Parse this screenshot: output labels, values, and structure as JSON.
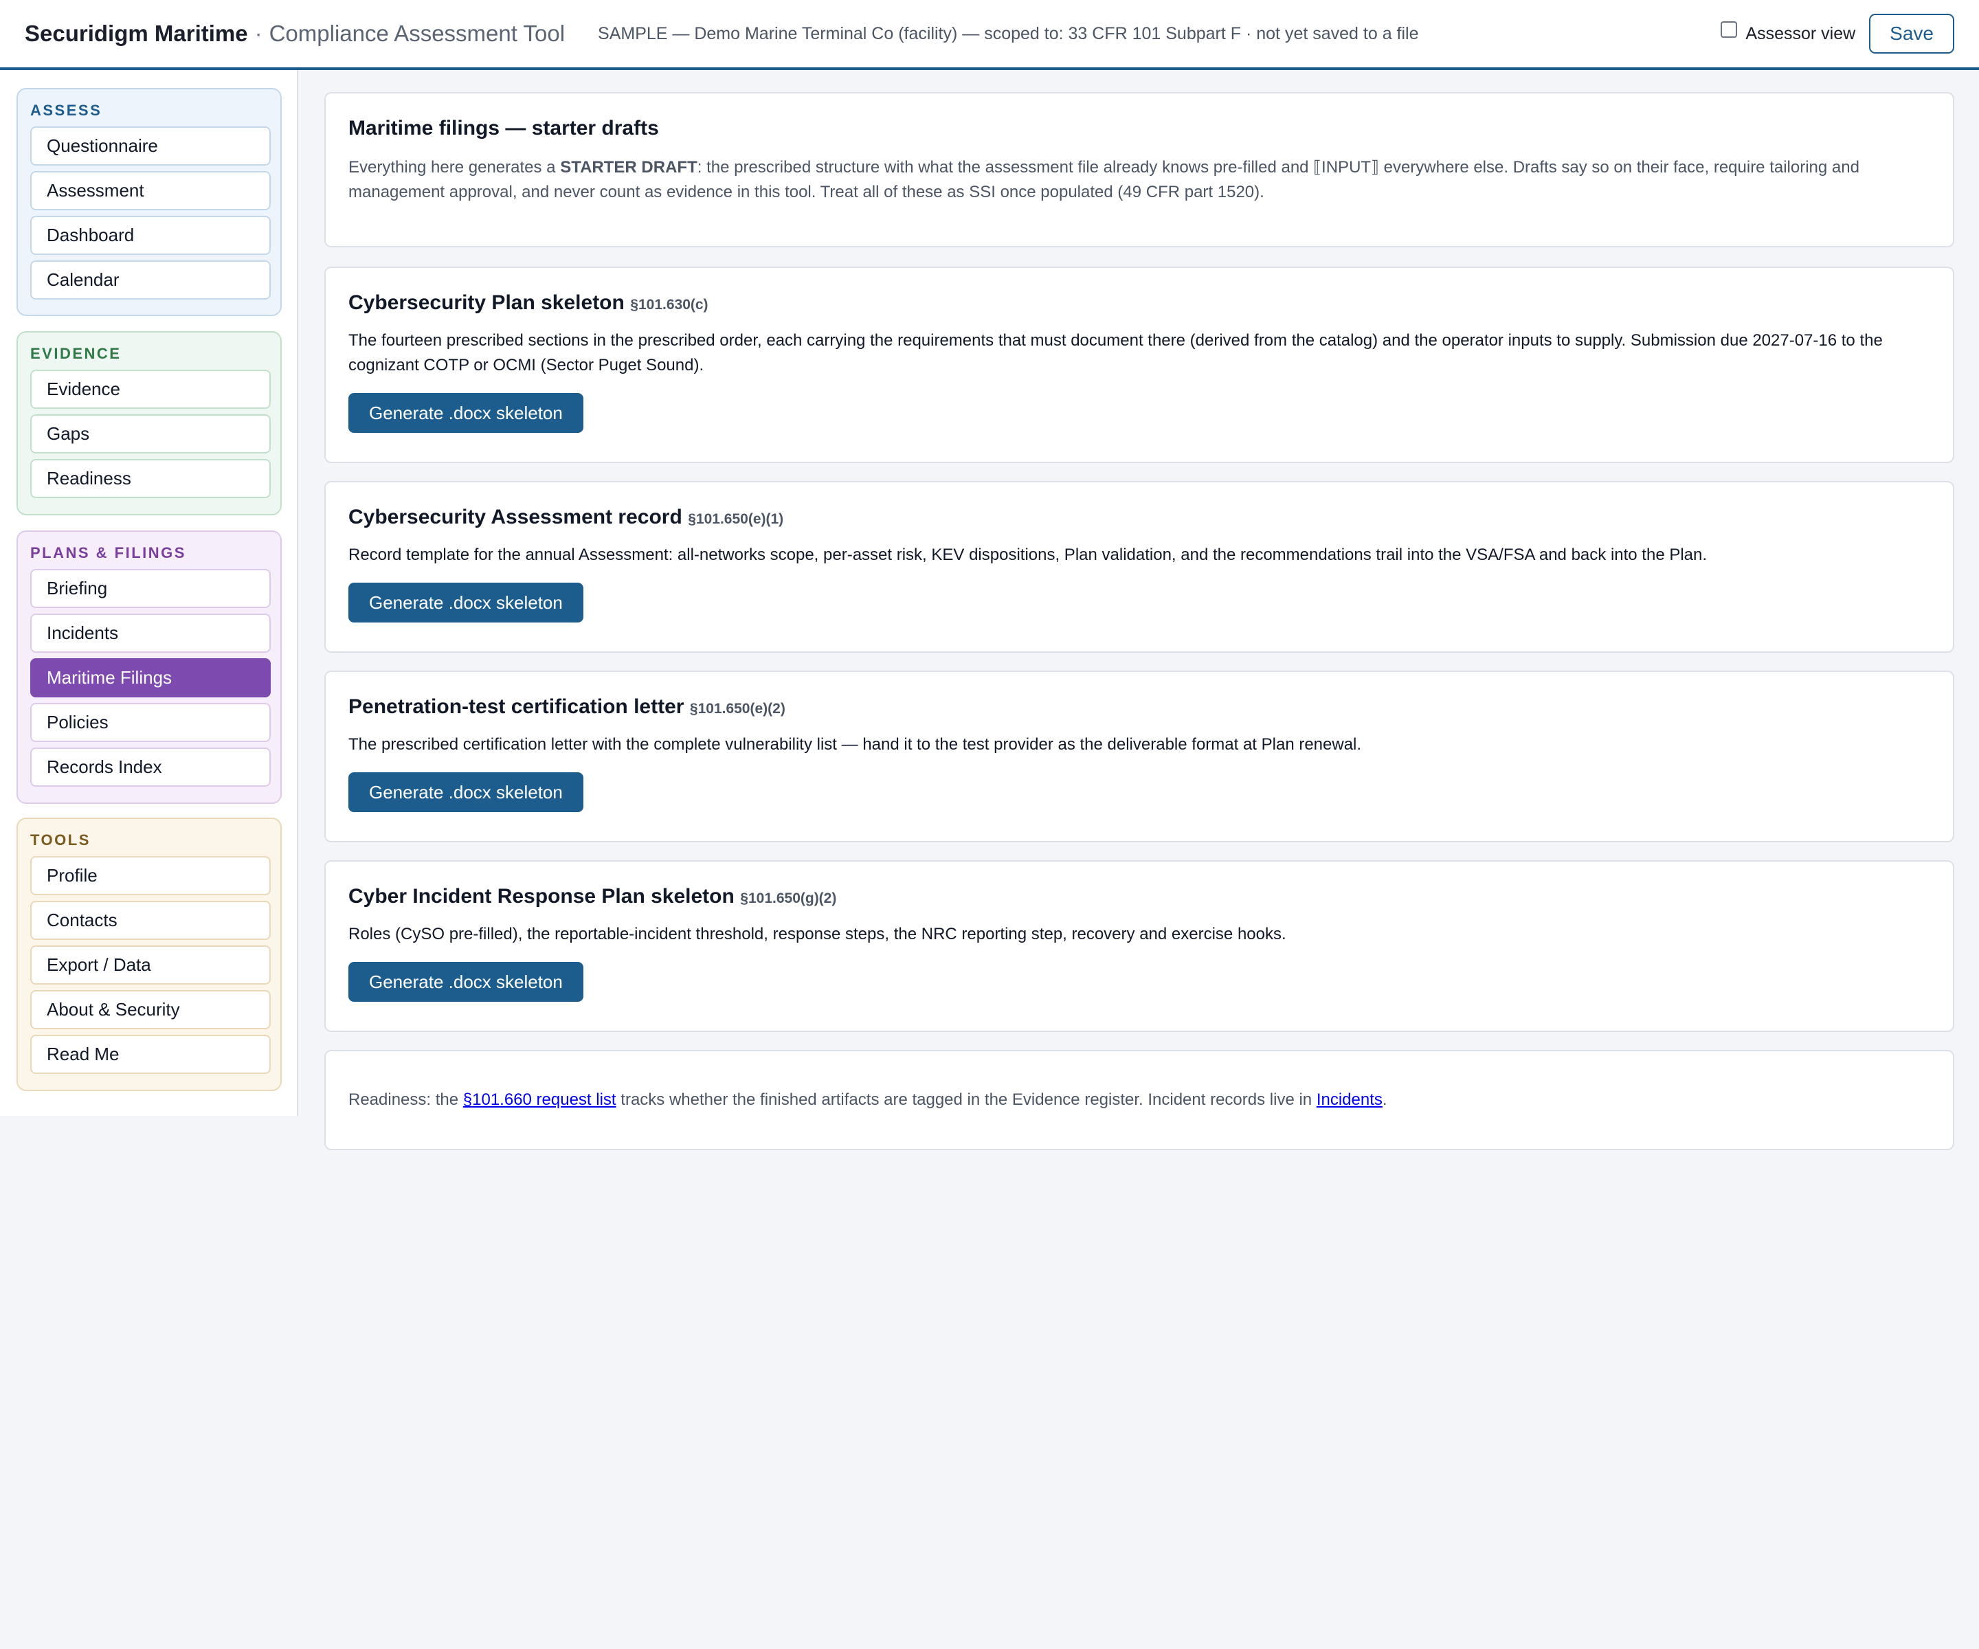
{
  "header": {
    "brand": "Securidigm Maritime",
    "separator": "·",
    "subtitle": "Compliance Assessment Tool",
    "file_status": "SAMPLE — Demo Marine Terminal Co (facility) — scoped to: 33 CFR 101 Subpart F · not yet saved to a file",
    "assessor_label": "Assessor view",
    "save_label": "Save"
  },
  "sidebar": {
    "assess": {
      "title": "Assess",
      "items": [
        "Questionnaire",
        "Assessment",
        "Dashboard",
        "Calendar"
      ]
    },
    "evidence": {
      "title": "Evidence",
      "items": [
        "Evidence",
        "Gaps",
        "Readiness"
      ]
    },
    "plans": {
      "title": "Plans & Filings",
      "items": [
        "Briefing",
        "Incidents",
        "Maritime Filings",
        "Policies",
        "Records Index"
      ],
      "active": "Maritime Filings"
    },
    "tools": {
      "title": "Tools",
      "items": [
        "Profile",
        "Contacts",
        "Export / Data",
        "About & Security",
        "Read Me"
      ]
    }
  },
  "intro": {
    "title": "Maritime filings — starter drafts",
    "body_pre": "Everything here generates a ",
    "body_strong": "STARTER DRAFT",
    "body_post": ": the prescribed structure with what the assessment file already knows pre-filled and ⟦INPUT⟧ everywhere else. Drafts say so on their face, require tailoring and management approval, and never count as evidence in this tool. Treat all of these as SSI once populated (49 CFR part 1520)."
  },
  "filings": [
    {
      "title": "Cybersecurity Plan skeleton",
      "section": "§101.630(c)",
      "description": "The fourteen prescribed sections in the prescribed order, each carrying the requirements that must document there (derived from the catalog) and the operator inputs to supply. Submission due 2027-07-16 to the cognizant COTP or OCMI (Sector Puget Sound).",
      "button": "Generate .docx skeleton"
    },
    {
      "title": "Cybersecurity Assessment record",
      "section": "§101.650(e)(1)",
      "description": "Record template for the annual Assessment: all-networks scope, per-asset risk, KEV dispositions, Plan validation, and the recommendations trail into the VSA/FSA and back into the Plan.",
      "button": "Generate .docx skeleton"
    },
    {
      "title": "Penetration-test certification letter",
      "section": "§101.650(e)(2)",
      "description": "The prescribed certification letter with the complete vulnerability list — hand it to the test provider as the deliverable format at Plan renewal.",
      "button": "Generate .docx skeleton"
    },
    {
      "title": "Cyber Incident Response Plan skeleton",
      "section": "§101.650(g)(2)",
      "description": "Roles (CySO pre-filled), the reportable-incident threshold, response steps, the NRC reporting step, recovery and exercise hooks.",
      "button": "Generate .docx skeleton"
    }
  ],
  "footer_note": {
    "pre": "Readiness: the ",
    "link1": "§101.660 request list",
    "mid": " tracks whether the finished artifacts are tagged in the Evidence register. Incident records live in ",
    "link2": "Incidents",
    "post": "."
  },
  "colors": {
    "accent": "#1d5d8e",
    "active_nav": "#7d4baf",
    "assess": "#1d5d8e",
    "evidence": "#2f7a47",
    "plans": "#7a3e9d",
    "tools": "#7a5a1e"
  }
}
